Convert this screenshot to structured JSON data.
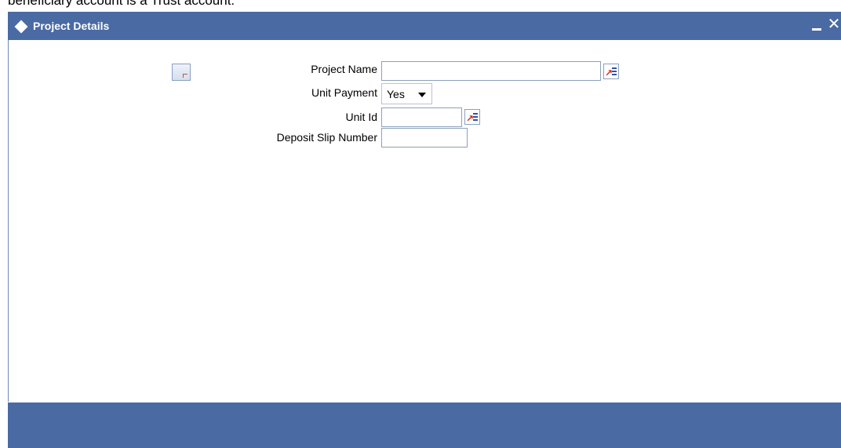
{
  "background": {
    "partial_text": "beneficiary account is a Trust account."
  },
  "window": {
    "title": "Project Details",
    "minimize_label": "minimize",
    "close_glyph": "✕",
    "titlebar_color": "#4a6aa4"
  },
  "form": {
    "project_name": {
      "label": "Project Name",
      "value": ""
    },
    "unit_payment": {
      "label": "Unit Payment",
      "selected": "Yes"
    },
    "unit_id": {
      "label": "Unit Id",
      "value": ""
    },
    "deposit_slip_number": {
      "label": "Deposit Slip Number",
      "value": ""
    }
  },
  "icons": {
    "page_icon": "document-icon",
    "lov": "list-of-values-icon"
  }
}
